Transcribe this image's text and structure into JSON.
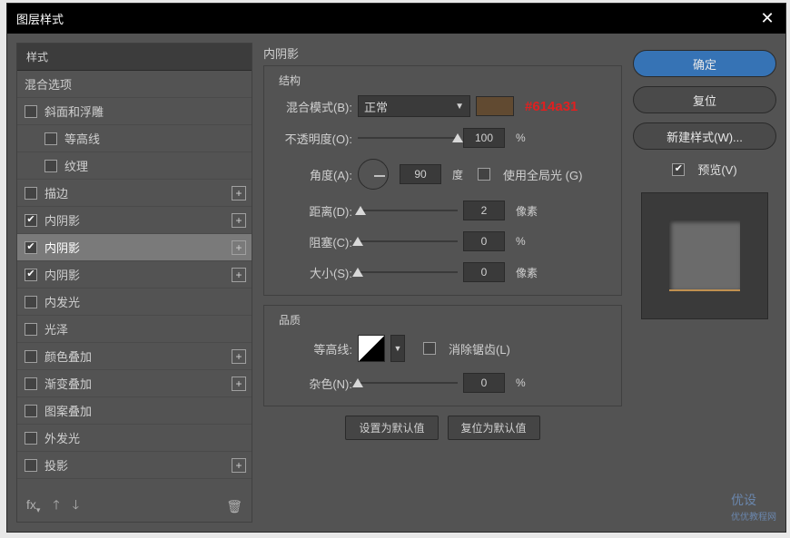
{
  "title": "图层样式",
  "left": {
    "header": "样式",
    "blend": "混合选项",
    "items": [
      {
        "label": "斜面和浮雕",
        "checked": false,
        "plus": false
      },
      {
        "label": "等高线",
        "checked": false,
        "indent": true,
        "plus": false
      },
      {
        "label": "纹理",
        "checked": false,
        "indent": true,
        "plus": false
      },
      {
        "label": "描边",
        "checked": false,
        "plus": true
      },
      {
        "label": "内阴影",
        "checked": true,
        "plus": true
      },
      {
        "label": "内阴影",
        "checked": true,
        "plus": true,
        "selected": true
      },
      {
        "label": "内阴影",
        "checked": true,
        "plus": true
      },
      {
        "label": "内发光",
        "checked": false,
        "plus": false
      },
      {
        "label": "光泽",
        "checked": false,
        "plus": false
      },
      {
        "label": "颜色叠加",
        "checked": false,
        "plus": true
      },
      {
        "label": "渐变叠加",
        "checked": false,
        "plus": true
      },
      {
        "label": "图案叠加",
        "checked": false,
        "plus": false
      },
      {
        "label": "外发光",
        "checked": false,
        "plus": false
      },
      {
        "label": "投影",
        "checked": false,
        "plus": true
      }
    ]
  },
  "mid": {
    "title": "内阴影",
    "structure": {
      "legend": "结构",
      "blendMode": {
        "label": "混合模式(B):",
        "value": "正常",
        "color": "#614a31",
        "annot": "#614a31"
      },
      "opacity": {
        "label": "不透明度(O):",
        "value": "100",
        "unit": "%",
        "pos": 100
      },
      "angle": {
        "label": "角度(A):",
        "value": "90",
        "unit": "度",
        "global": "使用全局光 (G)",
        "globalChecked": false
      },
      "distance": {
        "label": "距离(D):",
        "value": "2",
        "unit": "像素",
        "pos": 3
      },
      "choke": {
        "label": "阻塞(C):",
        "value": "0",
        "unit": "%",
        "pos": 0
      },
      "size": {
        "label": "大小(S):",
        "value": "0",
        "unit": "像素",
        "pos": 0
      }
    },
    "quality": {
      "legend": "品质",
      "contour": {
        "label": "等高线:",
        "anti": "消除锯齿(L)",
        "antiChecked": false
      },
      "noise": {
        "label": "杂色(N):",
        "value": "0",
        "unit": "%",
        "pos": 0
      }
    },
    "defaults": {
      "set": "设置为默认值",
      "reset": "复位为默认值"
    }
  },
  "right": {
    "ok": "确定",
    "cancel": "复位",
    "newStyle": "新建样式(W)...",
    "preview": "预览(V)"
  },
  "watermark": {
    "main": "优设",
    "sub": "优优教程网"
  }
}
